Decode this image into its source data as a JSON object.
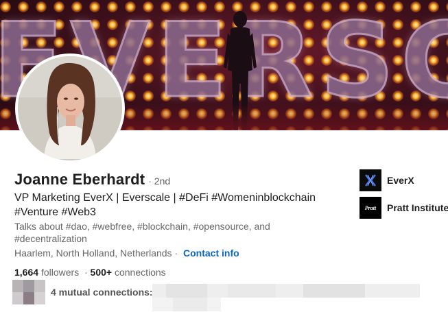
{
  "banner": {
    "word": "EVERSC"
  },
  "profile": {
    "name": "Joanne Eberhardt",
    "degree": "· 2nd",
    "headline": "VP Marketing EverX | Everscale | #DeFi #Womeninblockchain #Venture #Web3",
    "talks_about": "Talks about #dao, #webfree, #blockchain, #opensource, and #decentralization",
    "location": "Haarlem, North Holland, Netherlands ·",
    "contact_info_label": "Contact info",
    "followers_count": "1,664",
    "followers_label": "followers",
    "separator": "·",
    "connections_count": "500+",
    "connections_label": "connections",
    "mutual_label": "4 mutual connections:"
  },
  "companies": [
    {
      "name": "EverX",
      "logo_text": "",
      "icon": "everx-logo-icon"
    },
    {
      "name": "Pratt Institute",
      "logo_text": "Pratt",
      "icon": "pratt-logo-icon"
    }
  ],
  "colors": {
    "link": "#0a66c2",
    "text_primary": "#1d1d1d",
    "text_secondary": "#666666"
  }
}
